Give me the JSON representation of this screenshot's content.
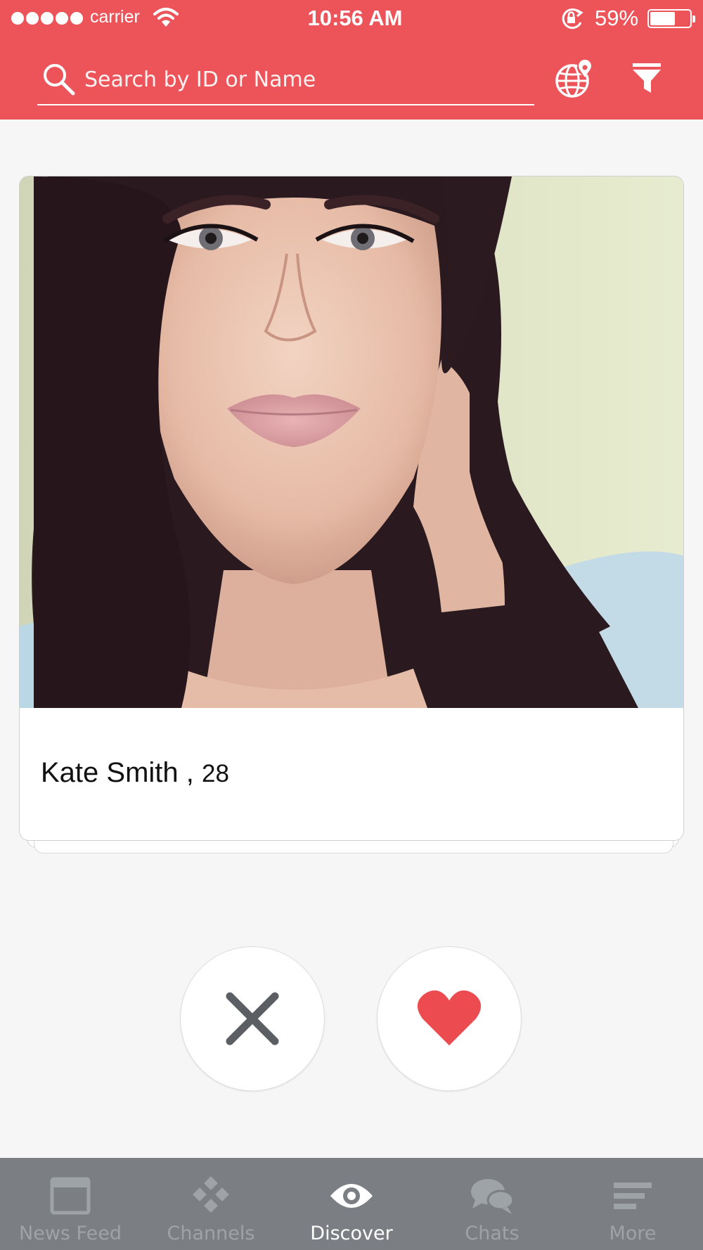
{
  "status_bar": {
    "carrier": "carrier",
    "time": "10:56 AM",
    "battery_percent": "59%",
    "battery_level": 0.59
  },
  "search": {
    "placeholder": "Search by ID or Name"
  },
  "header_icons": [
    "globe-location-icon",
    "filter-funnel-icon"
  ],
  "card": {
    "name": "Kate Smith",
    "separator": " , ",
    "age": "28"
  },
  "actions": {
    "dislike_icon": "x-icon",
    "like_icon": "heart-icon"
  },
  "tabs": [
    {
      "label": "News Feed",
      "icon": "news-feed-icon",
      "active": false
    },
    {
      "label": "Channels",
      "icon": "channels-icon",
      "active": false
    },
    {
      "label": "Discover",
      "icon": "eye-icon",
      "active": true
    },
    {
      "label": "Chats",
      "icon": "chat-bubbles-icon",
      "active": false
    },
    {
      "label": "More",
      "icon": "menu-lines-icon",
      "active": false
    }
  ],
  "colors": {
    "accent": "#ec5459",
    "tab_bar": "#7b7f84",
    "background": "#f6f6f6"
  }
}
